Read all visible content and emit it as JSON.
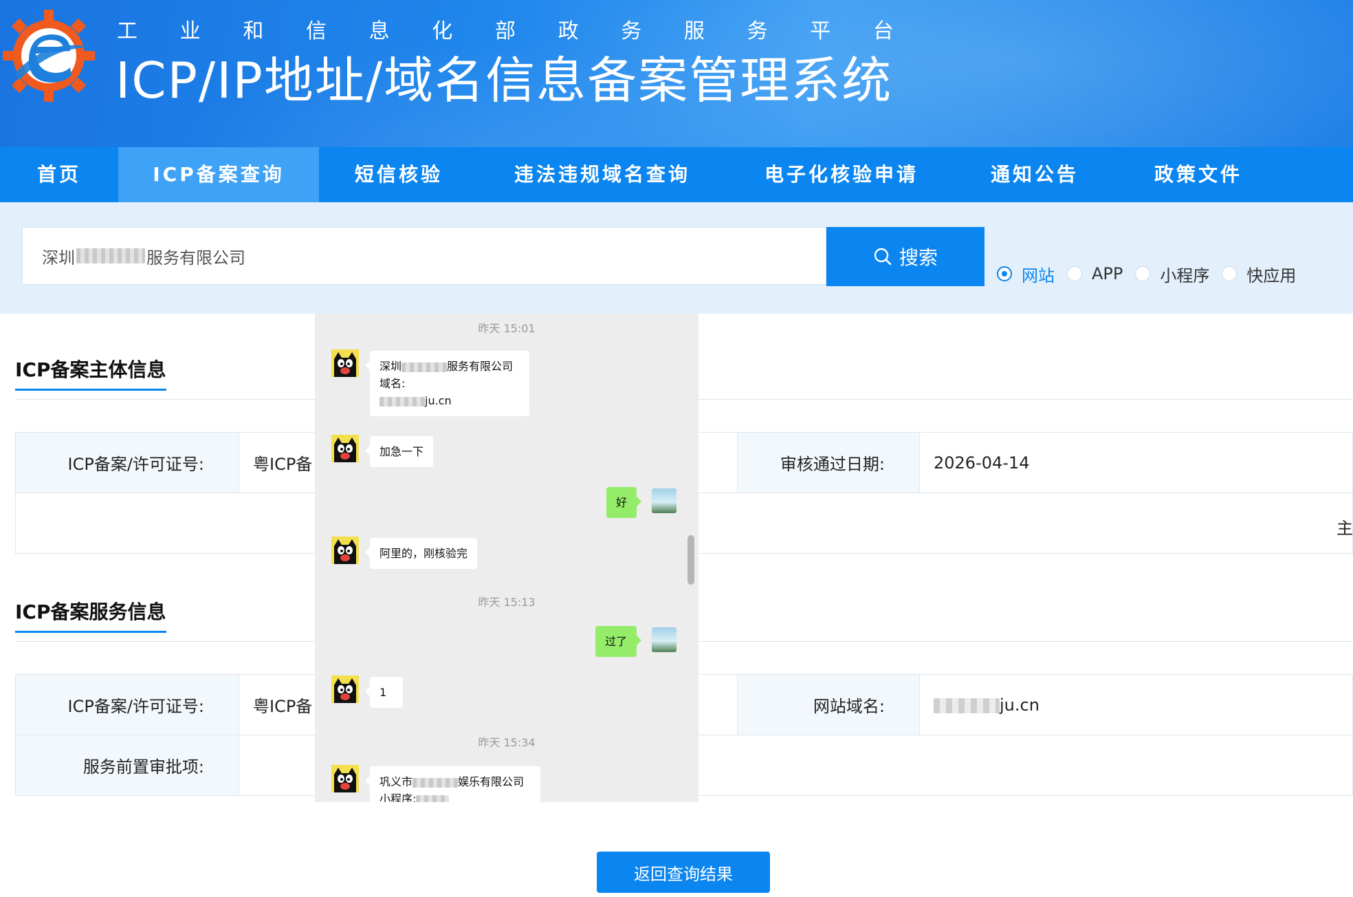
{
  "header": {
    "subtitle_chars": [
      "工",
      "业",
      "和",
      "信",
      "息",
      "化",
      "部",
      "政",
      "务",
      "服",
      "务",
      "平",
      "台"
    ],
    "title": "ICP/IP地址/域名信息备案管理系统"
  },
  "nav": {
    "items": [
      {
        "label": "首页"
      },
      {
        "label": "ICP备案查询"
      },
      {
        "label": "短信核验"
      },
      {
        "label": "违法违规域名查询"
      },
      {
        "label": "电子化核验申请"
      },
      {
        "label": "通知公告"
      },
      {
        "label": "政策文件"
      }
    ],
    "active": "ICP备案查询"
  },
  "search": {
    "value_prefix": "深圳",
    "value_suffix": "服务有限公司",
    "button_label": "搜索",
    "radios": [
      {
        "label": "网站",
        "checked": true
      },
      {
        "label": "APP",
        "checked": false
      },
      {
        "label": "小程序",
        "checked": false
      },
      {
        "label": "快应用",
        "checked": false
      }
    ]
  },
  "subject": {
    "title": "ICP备案主体信息",
    "license_label": "ICP备案/许可证号:",
    "license_value": "粤ICP备",
    "approve_label": "审核通过日期:",
    "approve_value": "2026-04-14",
    "edge_char": "主"
  },
  "service": {
    "title": "ICP备案服务信息",
    "license_label": "ICP备案/许可证号:",
    "license_value": "粤ICP备",
    "domain_label": "网站域名:",
    "domain_suffix": "ju.cn",
    "preapproval_label": "服务前置审批项:"
  },
  "return_button": "返回查询结果",
  "chat": {
    "ts1": "昨天 15:01",
    "msg1_line1_prefix": "深圳",
    "msg1_line1_suffix": "服务有限公司",
    "msg1_line2": "域名:",
    "msg1_line3_suffix": "ju.cn",
    "msg2": "加急一下",
    "msg3": "好",
    "msg4": "阿里的，刚核验完",
    "ts2": "昨天 15:13",
    "msg5": "过了",
    "msg6": "1",
    "ts3": "昨天 15:34",
    "msg7_prefix": "巩义市",
    "msg7_suffix": "娱乐有限公司",
    "msg7_line2": "小程序:"
  },
  "colors": {
    "brand_blue": "#0b85f0",
    "nav_active": "#3ea2f7",
    "search_bg": "#e3f0fb",
    "chat_bg": "#ededed",
    "chat_green": "#95ec69"
  }
}
